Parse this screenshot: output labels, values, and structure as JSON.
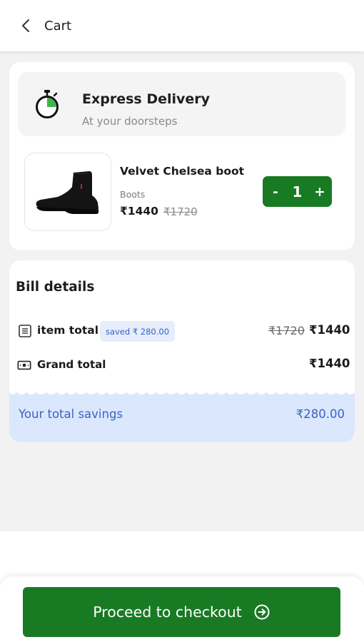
{
  "header": {
    "title": "Cart",
    "back_icon": "chevron-left-icon"
  },
  "delivery": {
    "title": "Express Delivery",
    "subtitle": "At your doorsteps",
    "icon": "stopwatch-icon"
  },
  "product": {
    "name": "Velvet Chelsea boot",
    "category": "Boots",
    "price": "₹1440",
    "mrp": "₹1720",
    "quantity": "1",
    "minus_label": "-",
    "plus_label": "+",
    "image": "black-chelsea-boot"
  },
  "bill": {
    "title": "Bill details",
    "item_total_label": "item total",
    "saved_badge": "saved ₹ 280.00",
    "item_total_mrp": "₹1720",
    "item_total_price": "₹1440",
    "grand_total_label": "Grand total",
    "grand_total_price": "₹1440",
    "savings_label": "Your total savings",
    "savings_value": "₹280.00"
  },
  "footer": {
    "checkout_label": "Proceed to checkout",
    "checkout_icon": "arrow-right-circle-icon"
  },
  "colors": {
    "brand_green": "#197a24",
    "savings_blue": "#3a64c6",
    "savings_bg": "#dbe7fc",
    "badge_bg": "#e6eefb"
  }
}
